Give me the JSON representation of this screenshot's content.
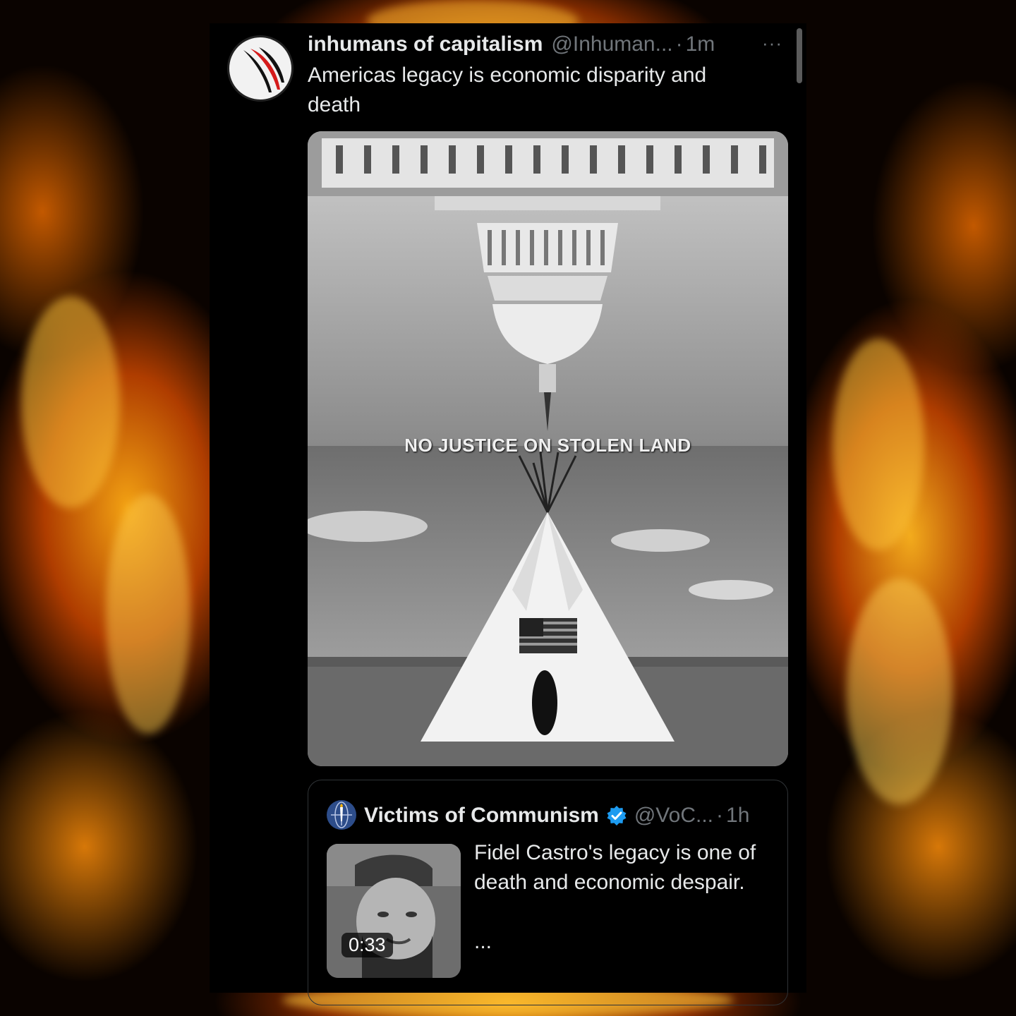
{
  "colors": {
    "panel_bg": "#000000",
    "text_primary": "#e7e9ea",
    "text_secondary": "#71767b",
    "verified_blue": "#1d9bf0",
    "fire_orange": "#ff9a14"
  },
  "tweet": {
    "avatar_icon": "feather-logo",
    "display_name": "inhumans of capitalism",
    "handle": "@Inhuman...",
    "separator": "·",
    "time": "1m",
    "more_label": "···",
    "text": "Americas legacy is economic disparity and death",
    "media": {
      "overlay_text": "NO JUSTICE ON STOLEN LAND"
    }
  },
  "quoted_tweet": {
    "avatar_icon": "torch-globe-logo",
    "display_name": "Victims of Communism",
    "verified_icon": "verified-badge-icon",
    "handle": "@VoC...",
    "separator": "·",
    "time": "1h",
    "video_duration": "0:33",
    "text": "Fidel Castro's legacy is one of death and economic despair.",
    "ellipsis": "..."
  }
}
